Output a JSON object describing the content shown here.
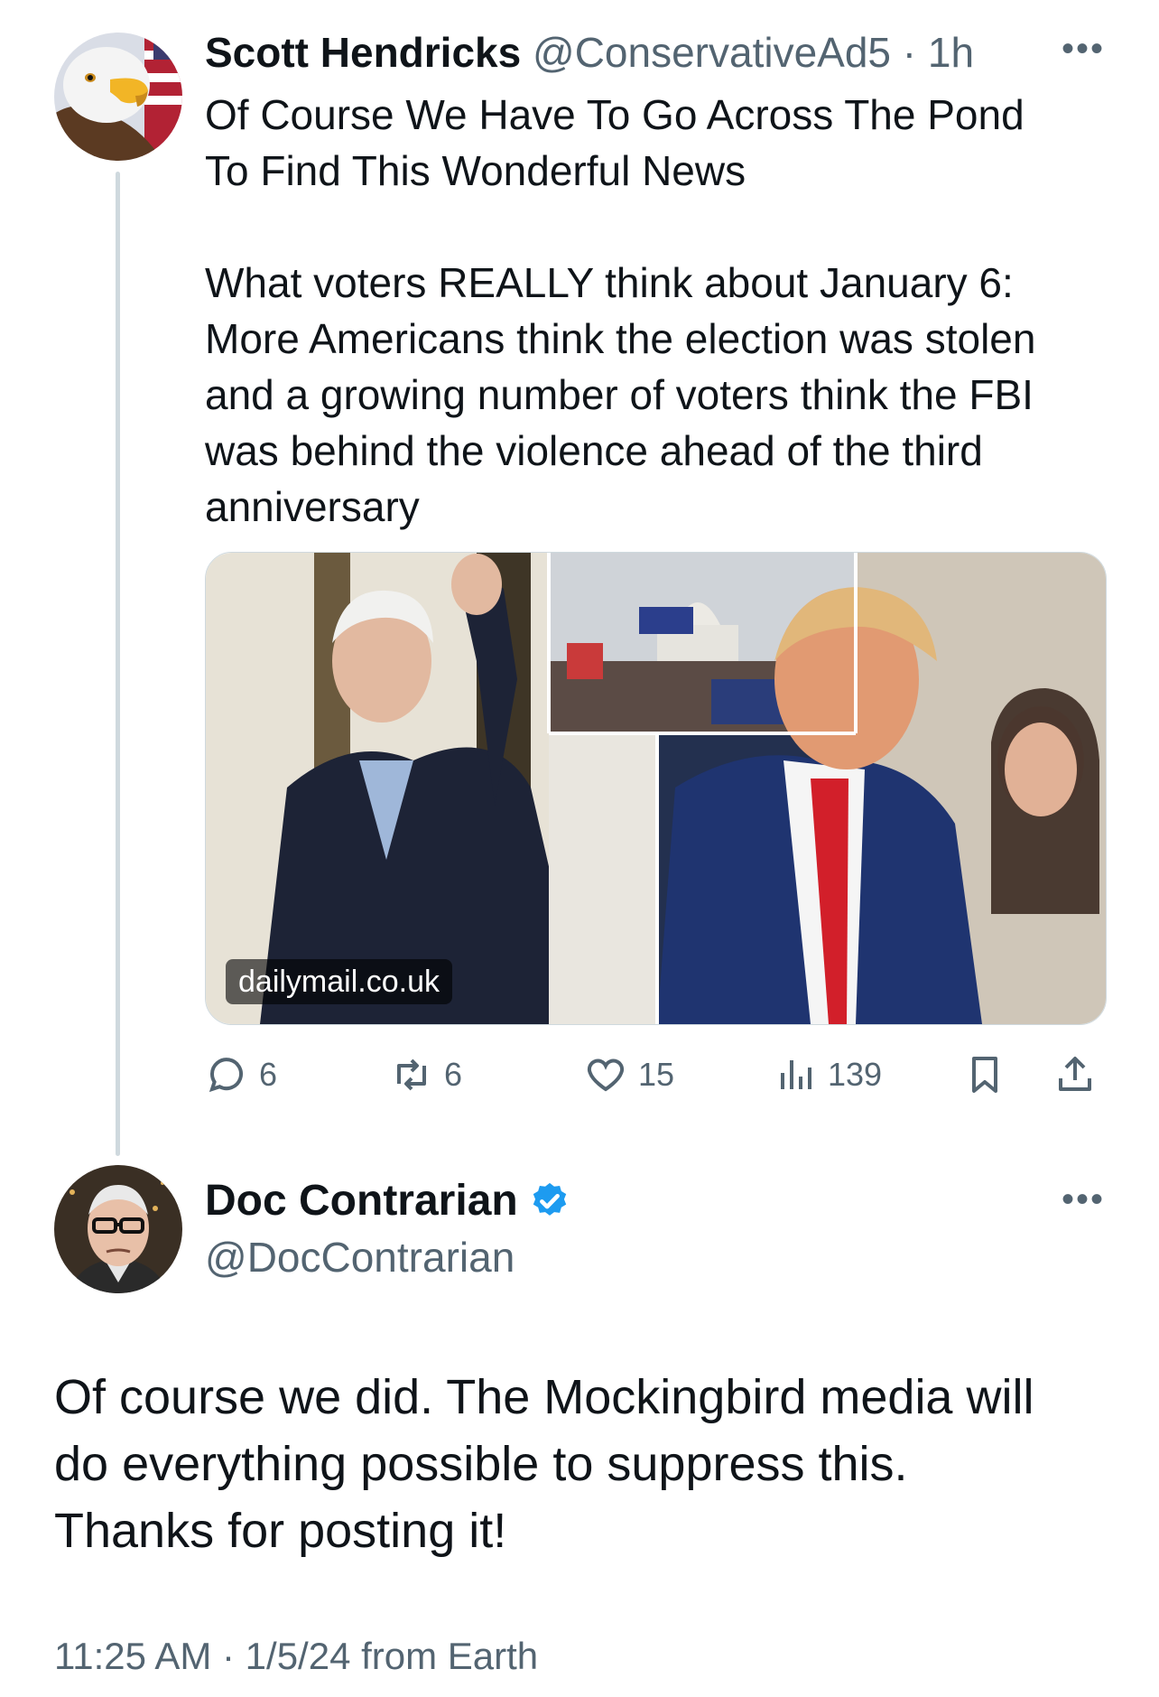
{
  "tweet": {
    "author_name": "Scott Hendricks",
    "author_handle": "@ConservativeAd5",
    "separator": "·",
    "time_ago": "1h",
    "more_label": "•••",
    "text": "Of Course We Have To Go Across The Pond\nTo Find This Wonderful News\n\nWhat voters REALLY think about January 6: More Americans think the election was stolen and a growing number of voters think the FBI was behind the violence ahead of the third anniversary",
    "card_source": "dailymail.co.uk",
    "stats": {
      "replies": "6",
      "reposts": "6",
      "likes": "15",
      "views": "139"
    }
  },
  "reply": {
    "author_name": "Doc Contrarian",
    "author_handle": "@DocContrarian",
    "more_label": "•••",
    "verified_color": "#1d9bf0",
    "text": "Of course we did. The Mockingbird media will\ndo everything possible to suppress this.\nThanks for posting it!",
    "meta": "11:25 AM · 1/5/24 from Earth"
  },
  "icons": [
    "reply-icon",
    "repost-icon",
    "like-icon",
    "views-icon",
    "bookmark-icon",
    "share-icon",
    "verified-badge-icon",
    "more-icon"
  ],
  "colors": {
    "secondary_text": "#536471",
    "primary_text": "#0f1419",
    "thread_line": "#cfd9de",
    "verified": "#1d9bf0"
  }
}
